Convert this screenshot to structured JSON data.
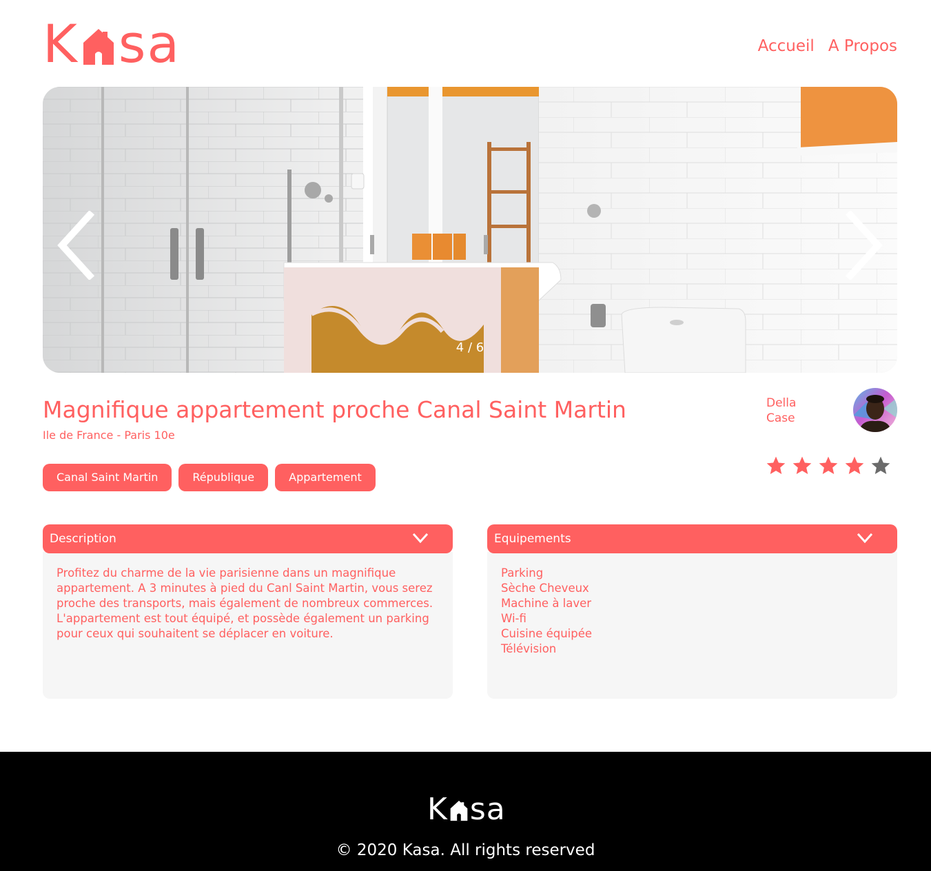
{
  "header": {
    "logo": {
      "text_before": "K",
      "text_after": "sa",
      "icon": "house-icon"
    },
    "nav": [
      {
        "label": "Accueil"
      },
      {
        "label": "A Propos"
      }
    ]
  },
  "carousel": {
    "counter": "4 / 6",
    "prev_icon": "chevron-left-icon",
    "next_icon": "chevron-right-icon"
  },
  "listing": {
    "title": "Magnifique appartement proche Canal Saint Martin",
    "location": "Ile de France - Paris 10e",
    "tags": [
      "Canal Saint Martin",
      "République",
      "Appartement"
    ],
    "host": {
      "first_name": "Della",
      "last_name": "Case"
    },
    "rating": {
      "value": 4,
      "max": 5,
      "filled_color": "#FF6060",
      "empty_color": "#6B6B6B"
    }
  },
  "description": {
    "title": "Description",
    "text": "Profitez du charme de la vie parisienne dans un magnifique appartement. A 3 minutes à pied du Canl Saint Martin, vous serez proche des transports, mais également de nombreux commerces. L'appartement est tout équipé, et possède également un parking pour ceux qui souhaitent se déplacer en voiture."
  },
  "equipments": {
    "title": "Equipements",
    "items": [
      "Parking",
      "Sèche Cheveux",
      "Machine à laver",
      "Wi-fi",
      "Cuisine équipée",
      "Télévision"
    ]
  },
  "footer": {
    "logo": {
      "text_before": "K",
      "text_after": "sa"
    },
    "copyright": "© 2020 Kasa. All rights reserved"
  },
  "colors": {
    "accent": "#FF6060",
    "panel": "#F6F6F6",
    "footer_bg": "#000000"
  }
}
